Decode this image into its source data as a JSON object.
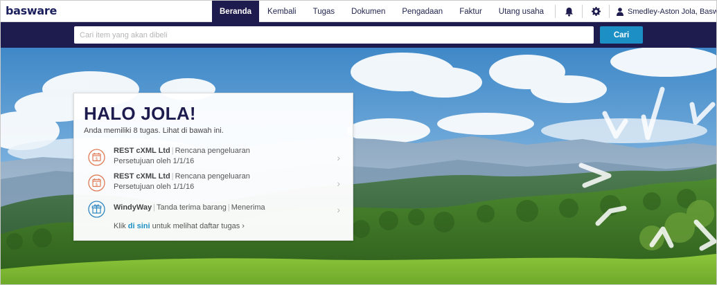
{
  "app": {
    "logo": "basware"
  },
  "nav": {
    "items": [
      {
        "label": "Beranda",
        "active": true
      },
      {
        "label": "Kembali",
        "active": false
      },
      {
        "label": "Tugas",
        "active": false
      },
      {
        "label": "Dokumen",
        "active": false
      },
      {
        "label": "Pengadaan",
        "active": false
      },
      {
        "label": "Faktur",
        "active": false
      },
      {
        "label": "Utang usaha",
        "active": false
      }
    ],
    "icons": [
      "bell-icon",
      "gear-icon",
      "user-icon",
      "caret-down-icon"
    ],
    "user": "Smedley-Aston Jola, Basware Oyj"
  },
  "search": {
    "placeholder": "Cari item yang akan dibeli",
    "value": "",
    "button": "Cari"
  },
  "colors": {
    "navy": "#1e1b4f",
    "accent": "#1c8fc4",
    "task_icon_orange": "#e07a55",
    "task_icon_blue": "#2f86c0"
  },
  "card": {
    "title": "HALO JOLA!",
    "subtitle": "Anda memiliki 8 tugas. Lihat di bawah ini.",
    "tasks": [
      {
        "icon": "calendar-money-icon",
        "supplier": "REST cXML Ltd",
        "type": "Rencana pengeluaran",
        "detail": "Persetujuan oleh 1/1/16"
      },
      {
        "icon": "calendar-money-icon",
        "supplier": "REST cXML Ltd",
        "type": "Rencana pengeluaran",
        "detail": "Persetujuan oleh 1/1/16"
      },
      {
        "icon": "gift-box-icon",
        "supplier": "WindyWay",
        "type": "Tanda terima barang",
        "detail": "Menerima"
      }
    ],
    "footer": {
      "prefix": "Klik",
      "link": "di sini",
      "suffix": "untuk melihat daftar tugas ›"
    }
  }
}
